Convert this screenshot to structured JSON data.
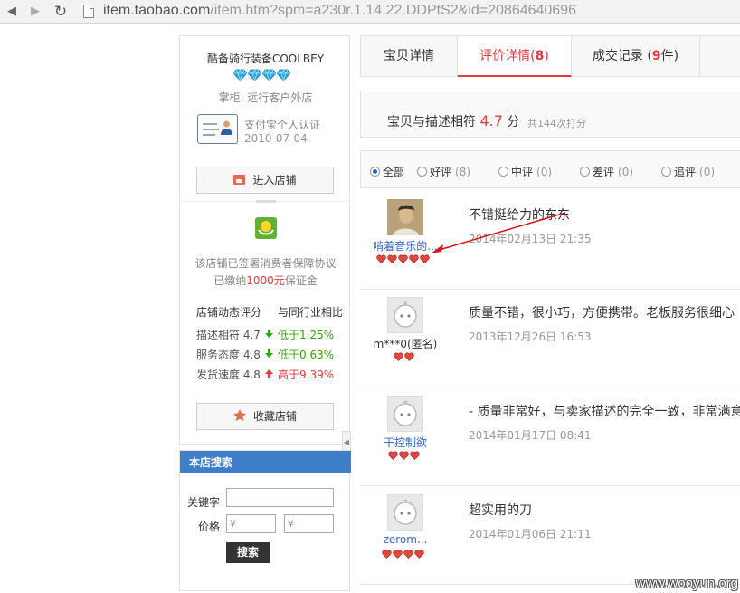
{
  "browser": {
    "url_host": "item.taobao.com",
    "url_path": "/item.htm?spm=a230r.1.14.22.DDPtS2&id=20864640696"
  },
  "shop": {
    "name": "酷备骑行装备COOLBEY",
    "keeper": "掌柜: 远行客户外店",
    "auth_title": "支付宝个人认证",
    "auth_date": "2010-07-04",
    "enter_label": "进入店铺",
    "guarantee_line1": "该店铺已签署消费者保障协议",
    "guarantee_prefix": "已缴纳",
    "guarantee_amount": "1000元",
    "guarantee_suffix": "保证金",
    "rating_head_left": "店铺动态评分",
    "rating_head_right": "与同行业相比",
    "ratings": [
      {
        "label": "描述相符 4.7",
        "compare": "低于1.25%",
        "trend": "down"
      },
      {
        "label": "服务态度 4.8",
        "compare": "低于0.63%",
        "trend": "down"
      },
      {
        "label": "发货速度 4.8",
        "compare": "高于9.39%",
        "trend": "up"
      }
    ],
    "favorite_label": "收藏店铺"
  },
  "shop_search": {
    "title": "本店搜索",
    "keyword_label": "关键字",
    "price_label": "价格",
    "price_min_placeholder": "¥",
    "price_max_placeholder": "¥",
    "search_label": "搜索"
  },
  "tabs": {
    "detail": "宝贝详情",
    "reviews_label": "评价详情(",
    "reviews_count": "8",
    "reviews_close": ")",
    "trades_label": "成交记录 (",
    "trades_count": "9",
    "trades_close": "件)"
  },
  "score": {
    "label": "宝贝与描述相符",
    "value": "4.7",
    "unit": "分",
    "count": "共144次打分"
  },
  "filters": [
    {
      "label": "全部",
      "count": "",
      "selected": true
    },
    {
      "label": "好评",
      "count": "(8)",
      "selected": false
    },
    {
      "label": "中评",
      "count": "(0)",
      "selected": false
    },
    {
      "label": "差评",
      "count": "(0)",
      "selected": false
    },
    {
      "label": "追评",
      "count": "(0)",
      "selected": false
    }
  ],
  "reviews": [
    {
      "author": "啃着音乐的...",
      "text": "不错挺给力的东东",
      "date": "2014年02月13日 21:35",
      "hearts": 5,
      "avatar": "photo"
    },
    {
      "author": "m***0(匿名)",
      "text": "质量不错，很小巧，方便携带。老板服务很细心",
      "date": "2013年12月26日 16:53",
      "hearts": 2,
      "avatar": "default"
    },
    {
      "author": "干控制欲",
      "text": "- 质量非常好，与卖家描述的完全一致，非常满意",
      "date": "2014年01月17日 08:41",
      "hearts": 3,
      "avatar": "default"
    },
    {
      "author": "zerom...",
      "text": "超实用的刀",
      "date": "2014年01月06日 21:11",
      "hearts": 4,
      "avatar": "default"
    }
  ],
  "watermark": "www.wooyun.org",
  "colors": {
    "accent_red": "#e4393c",
    "link_blue": "#3366cc",
    "search_header": "#3f7ec9",
    "diamond": "#2aa7e0",
    "heart": "#e2473f"
  }
}
